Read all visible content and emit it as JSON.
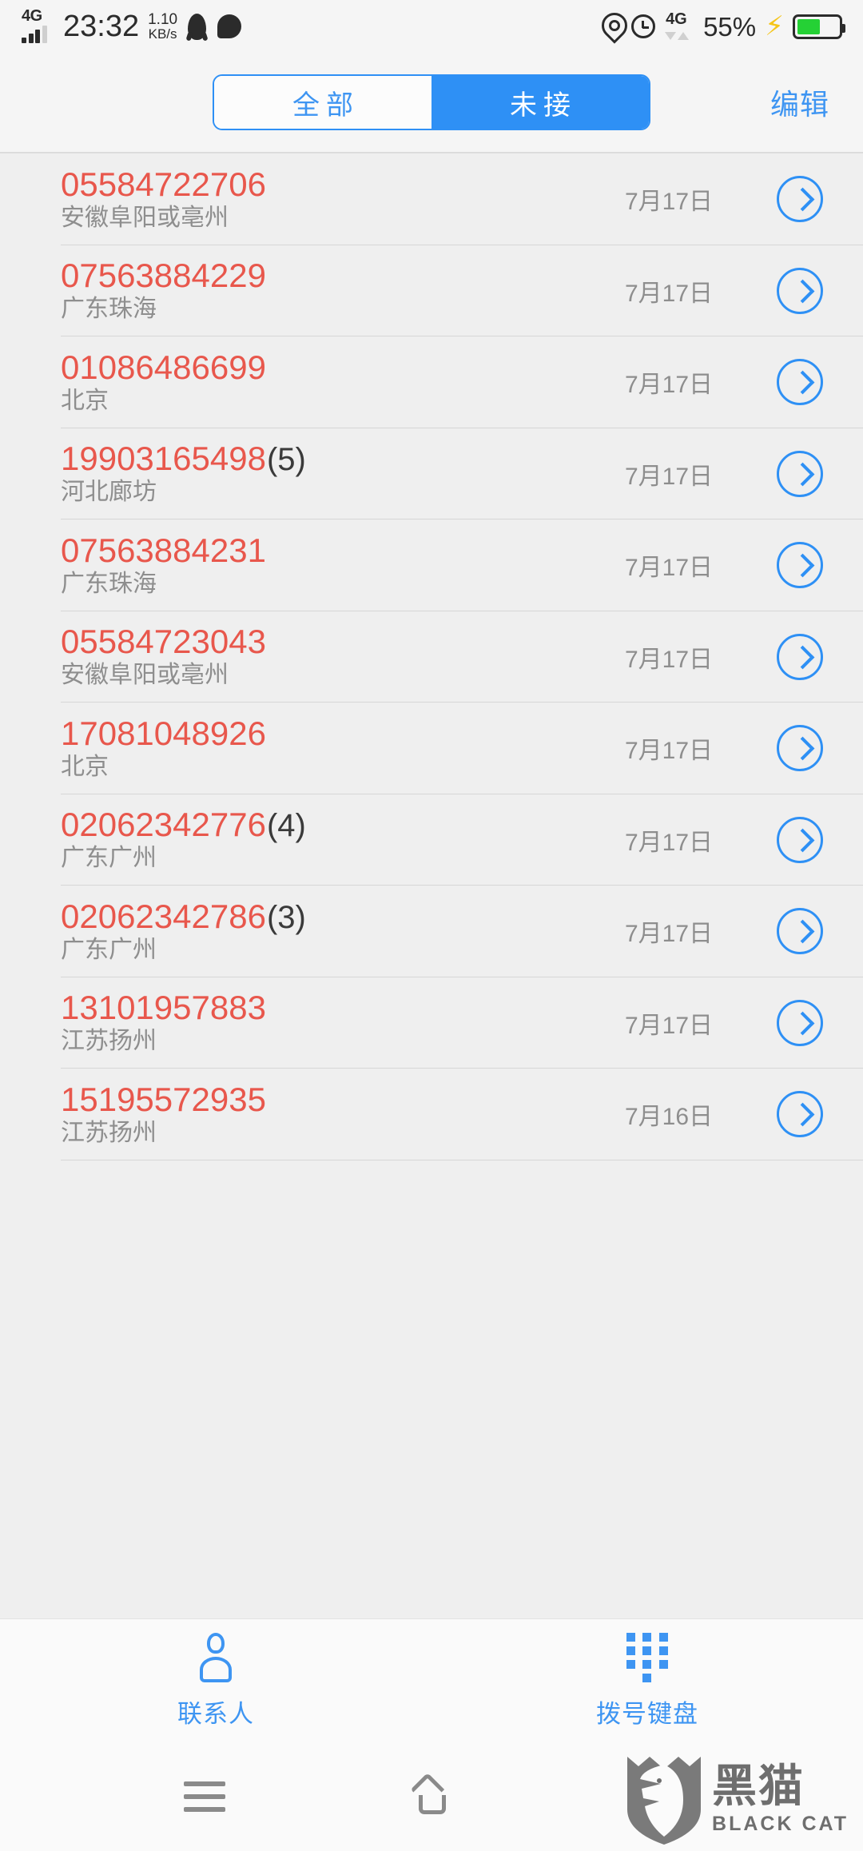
{
  "statusbar": {
    "network_label": "4G",
    "time": "23:32",
    "netspeed_value": "1.10",
    "netspeed_unit": "KB/s",
    "network_label_right": "4G",
    "battery_percent": "55%",
    "icons": [
      "qq-icon",
      "chat-icon",
      "location-pin-icon",
      "alarm-clock-icon",
      "charging-bolt-icon",
      "battery-icon"
    ],
    "accent": "#2b2b2b",
    "battery_fill_color": "#25d135"
  },
  "header": {
    "tabs": [
      {
        "label": "全部",
        "active": false
      },
      {
        "label": "未接",
        "active": true
      }
    ],
    "edit_label": "编辑",
    "accent": "#2e90f5"
  },
  "call_list": {
    "number_color": "#e8574c",
    "rows": [
      {
        "number": "05584722706",
        "count": "",
        "location": "安徽阜阳或亳州",
        "date": "7月17日"
      },
      {
        "number": "07563884229",
        "count": "",
        "location": "广东珠海",
        "date": "7月17日"
      },
      {
        "number": "01086486699",
        "count": "",
        "location": "北京",
        "date": "7月17日"
      },
      {
        "number": "19903165498",
        "count": "(5)",
        "location": "河北廊坊",
        "date": "7月17日"
      },
      {
        "number": "07563884231",
        "count": "",
        "location": "广东珠海",
        "date": "7月17日"
      },
      {
        "number": "05584723043",
        "count": "",
        "location": "安徽阜阳或亳州",
        "date": "7月17日"
      },
      {
        "number": "17081048926",
        "count": "",
        "location": "北京",
        "date": "7月17日"
      },
      {
        "number": "02062342776",
        "count": "(4)",
        "location": "广东广州",
        "date": "7月17日"
      },
      {
        "number": "02062342786",
        "count": "(3)",
        "location": "广东广州",
        "date": "7月17日"
      },
      {
        "number": "13101957883",
        "count": "",
        "location": "江苏扬州",
        "date": "7月17日"
      },
      {
        "number": "15195572935",
        "count": "",
        "location": "江苏扬州",
        "date": "7月16日"
      }
    ]
  },
  "tabbar": {
    "items": [
      {
        "label": "联系人",
        "icon": "person-icon"
      },
      {
        "label": "拨号键盘",
        "icon": "dialpad-icon"
      }
    ],
    "accent": "#3e95f2"
  },
  "navbar": {
    "recent_icon": "recents-menu-icon",
    "home_icon": "home-icon"
  },
  "watermark": {
    "cn": "黑猫",
    "en": "BLACK CAT"
  }
}
